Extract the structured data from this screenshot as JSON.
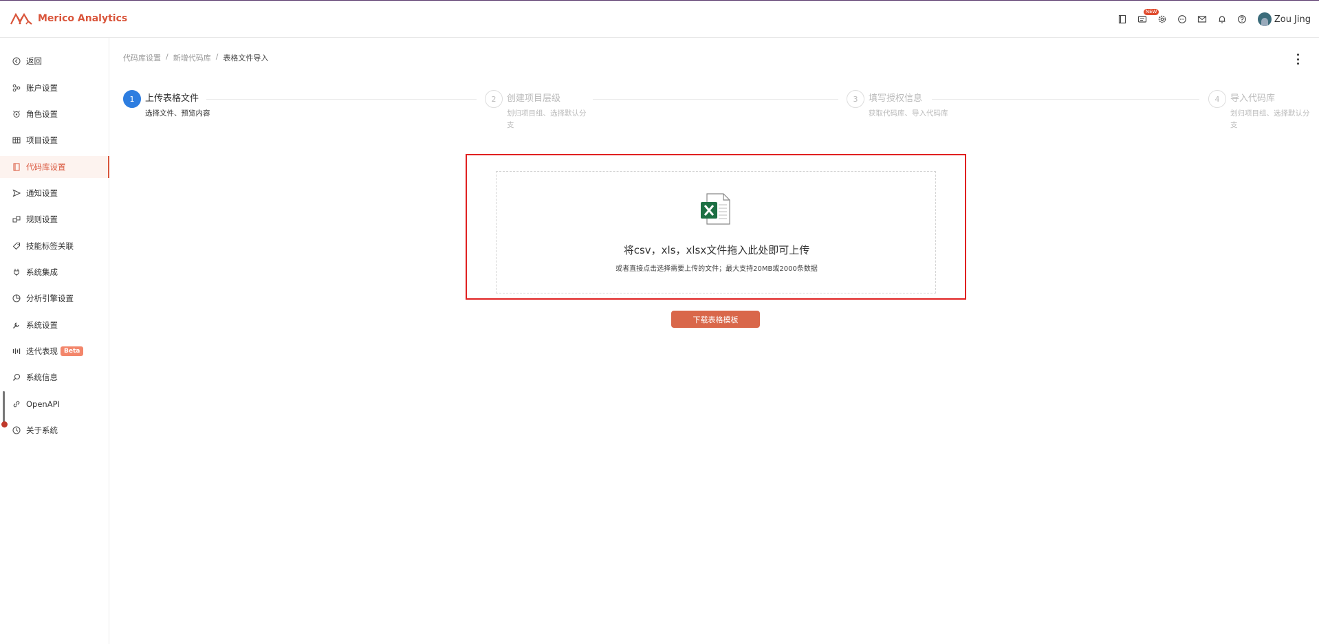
{
  "app": {
    "title": "Merico Analytics",
    "brand_color": "#d9553b"
  },
  "topbar": {
    "icons": [
      "book-icon",
      "news-icon",
      "settings-icon",
      "chat-icon",
      "mail-icon",
      "bell-icon",
      "help-icon"
    ],
    "new_badge": "NEW",
    "user_name": "Zou Jing"
  },
  "sidebar": {
    "items": [
      {
        "label": "返回",
        "icon": "back-icon"
      },
      {
        "label": "账户设置",
        "icon": "account-icon"
      },
      {
        "label": "角色设置",
        "icon": "role-icon"
      },
      {
        "label": "项目设置",
        "icon": "project-icon"
      },
      {
        "label": "代码库设置",
        "icon": "repo-icon",
        "active": true
      },
      {
        "label": "通知设置",
        "icon": "notify-icon"
      },
      {
        "label": "规则设置",
        "icon": "rule-icon"
      },
      {
        "label": "技能标签关联",
        "icon": "tag-icon"
      },
      {
        "label": "系统集成",
        "icon": "integration-icon"
      },
      {
        "label": "分析引擎设置",
        "icon": "engine-icon"
      },
      {
        "label": "系统设置",
        "icon": "wrench-icon"
      },
      {
        "label": "迭代表现",
        "icon": "iteration-icon",
        "badge": "Beta"
      },
      {
        "label": "系统信息",
        "icon": "info-search-icon"
      },
      {
        "label": "OpenAPI",
        "icon": "link-icon"
      },
      {
        "label": "关于系统",
        "icon": "about-icon"
      }
    ]
  },
  "breadcrumb": {
    "items": [
      "代码库设置",
      "新增代码库",
      "表格文件导入"
    ],
    "separator": "/"
  },
  "steps": [
    {
      "num": "1",
      "title": "上传表格文件",
      "desc": "选择文件、预览内容",
      "active": true
    },
    {
      "num": "2",
      "title": "创建项目层级",
      "desc": "划归项目组、选择默认分支"
    },
    {
      "num": "3",
      "title": "填写授权信息",
      "desc": "获取代码库、导入代码库"
    },
    {
      "num": "4",
      "title": "导入代码库",
      "desc": "划归项目组、选择默认分支"
    }
  ],
  "upload": {
    "title": "将csv，xls，xlsx文件拖入此处即可上传",
    "subtitle": "或者直接点击选择需要上传的文件；最大支持20MB或2000条数据",
    "file_icon": "excel-file-icon"
  },
  "download_button": {
    "label": "下载表格模板"
  }
}
